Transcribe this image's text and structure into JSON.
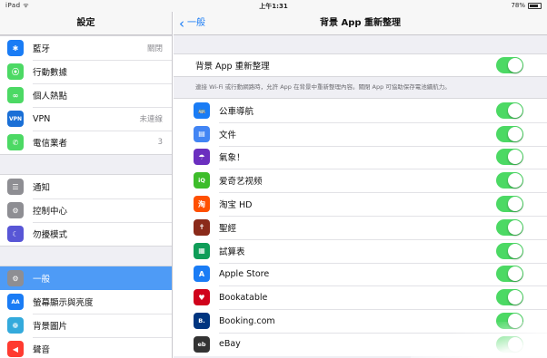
{
  "status_bar": {
    "left": "iPad ᯤ",
    "time": "上午1:31",
    "battery_text": "78%",
    "battery_level": 0.78
  },
  "sidebar": {
    "title": "設定",
    "groups": [
      [
        {
          "label": "藍牙",
          "value": "關閉",
          "icon": "bluetooth-icon",
          "color": "#1a7cf5",
          "glyph": "✱"
        },
        {
          "label": "行動數據",
          "value": "",
          "icon": "cellular-icon",
          "color": "#4cd964",
          "glyph": "⦿"
        },
        {
          "label": "個人熱點",
          "value": "",
          "icon": "hotspot-icon",
          "color": "#4cd964",
          "glyph": "∞"
        },
        {
          "label": "VPN",
          "value": "未連線",
          "icon": "vpn-icon",
          "color": "#1a6fd6",
          "glyph": "VPN"
        },
        {
          "label": "電信業者",
          "value": "3",
          "icon": "phone-icon",
          "color": "#4cd964",
          "glyph": "✆"
        }
      ],
      [
        {
          "label": "通知",
          "value": "",
          "icon": "notifications-icon",
          "color": "#8e8e93",
          "glyph": "☰"
        },
        {
          "label": "控制中心",
          "value": "",
          "icon": "control-center-icon",
          "color": "#8e8e93",
          "glyph": "⚙"
        },
        {
          "label": "勿擾模式",
          "value": "",
          "icon": "moon-icon",
          "color": "#5856d6",
          "glyph": "☾"
        }
      ],
      [
        {
          "label": "一般",
          "value": "",
          "icon": "gear-icon",
          "color": "#8e8e93",
          "glyph": "⚙",
          "selected": true
        },
        {
          "label": "螢幕顯示與亮度",
          "value": "",
          "icon": "display-icon",
          "color": "#1a7cf5",
          "glyph": "AA"
        },
        {
          "label": "背景圖片",
          "value": "",
          "icon": "wallpaper-icon",
          "color": "#34aadc",
          "glyph": "❁"
        },
        {
          "label": "聲音",
          "value": "",
          "icon": "sound-icon",
          "color": "#ff3b30",
          "glyph": "◀"
        }
      ]
    ]
  },
  "navbar": {
    "back_label": "一般",
    "title": "背景 App 重新整理"
  },
  "master_toggle": {
    "label": "背景 App 重新整理",
    "on": true
  },
  "footnote": "連接 Wi-Fi 或行動網路時，允許 App 在背景中重新整理內容。關閉 App 可協助保存電池續航力。",
  "apps": [
    {
      "label": "公車導航",
      "icon": "bus-icon",
      "color": "#1a7cf5",
      "glyph": "🚌",
      "on": true
    },
    {
      "label": "文件",
      "icon": "docs-icon",
      "color": "#4285f4",
      "glyph": "▤",
      "on": true
    },
    {
      "label": "氣象！",
      "icon": "yahoo-weather-icon",
      "color": "#6b2fbf",
      "glyph": "☂",
      "on": true
    },
    {
      "label": "爱奇艺视频",
      "icon": "iqiyi-icon",
      "color": "#3dbd2a",
      "glyph": "iQ",
      "on": true
    },
    {
      "label": "淘宝 HD",
      "icon": "taobao-icon",
      "color": "#ff5000",
      "glyph": "淘",
      "on": true
    },
    {
      "label": "聖經",
      "icon": "bible-icon",
      "color": "#8a2a1a",
      "glyph": "✝",
      "on": true
    },
    {
      "label": "試算表",
      "icon": "sheets-icon",
      "color": "#0f9d58",
      "glyph": "▦",
      "on": true
    },
    {
      "label": "Apple Store",
      "icon": "apple-store-icon",
      "color": "#1a7cf5",
      "glyph": "A",
      "on": true
    },
    {
      "label": "Bookatable",
      "icon": "bookatable-icon",
      "color": "#d0021b",
      "glyph": "♥",
      "on": true
    },
    {
      "label": "Booking.com",
      "icon": "booking-icon",
      "color": "#003580",
      "glyph": "B.",
      "on": true
    },
    {
      "label": "eBay",
      "icon": "ebay-icon",
      "color": "#333333",
      "glyph": "eb",
      "on": true
    }
  ]
}
